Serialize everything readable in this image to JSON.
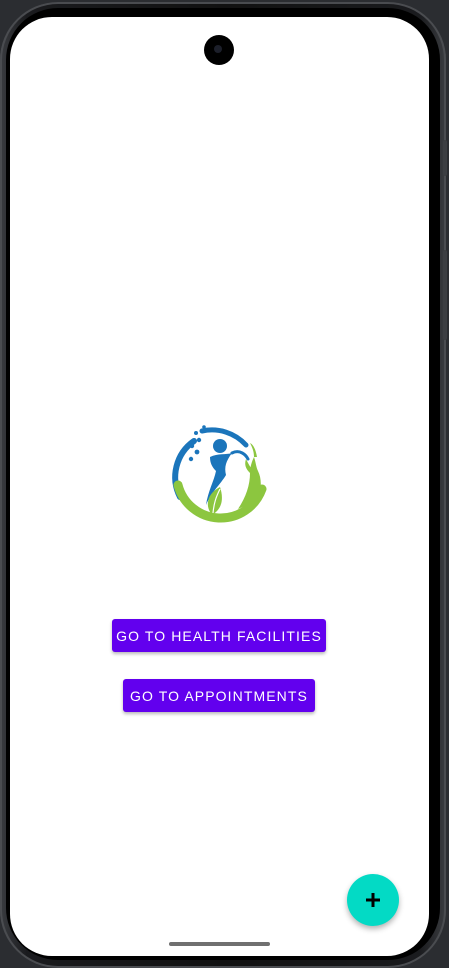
{
  "app": {
    "logo": {
      "icon": "health-wellness-logo-icon",
      "colors": {
        "blue": "#1b75bb",
        "green": "#8cc63f",
        "dark_green": "#5aa532"
      }
    },
    "buttons": {
      "health_facilities_label": "GO TO HEALTH FACILITIES",
      "appointments_label": "GO TO APPOINTMENTS"
    },
    "fab": {
      "icon": "plus-icon"
    }
  },
  "theme": {
    "primary": "#6200ee",
    "secondary": "#03dac5",
    "background": "#ffffff"
  }
}
